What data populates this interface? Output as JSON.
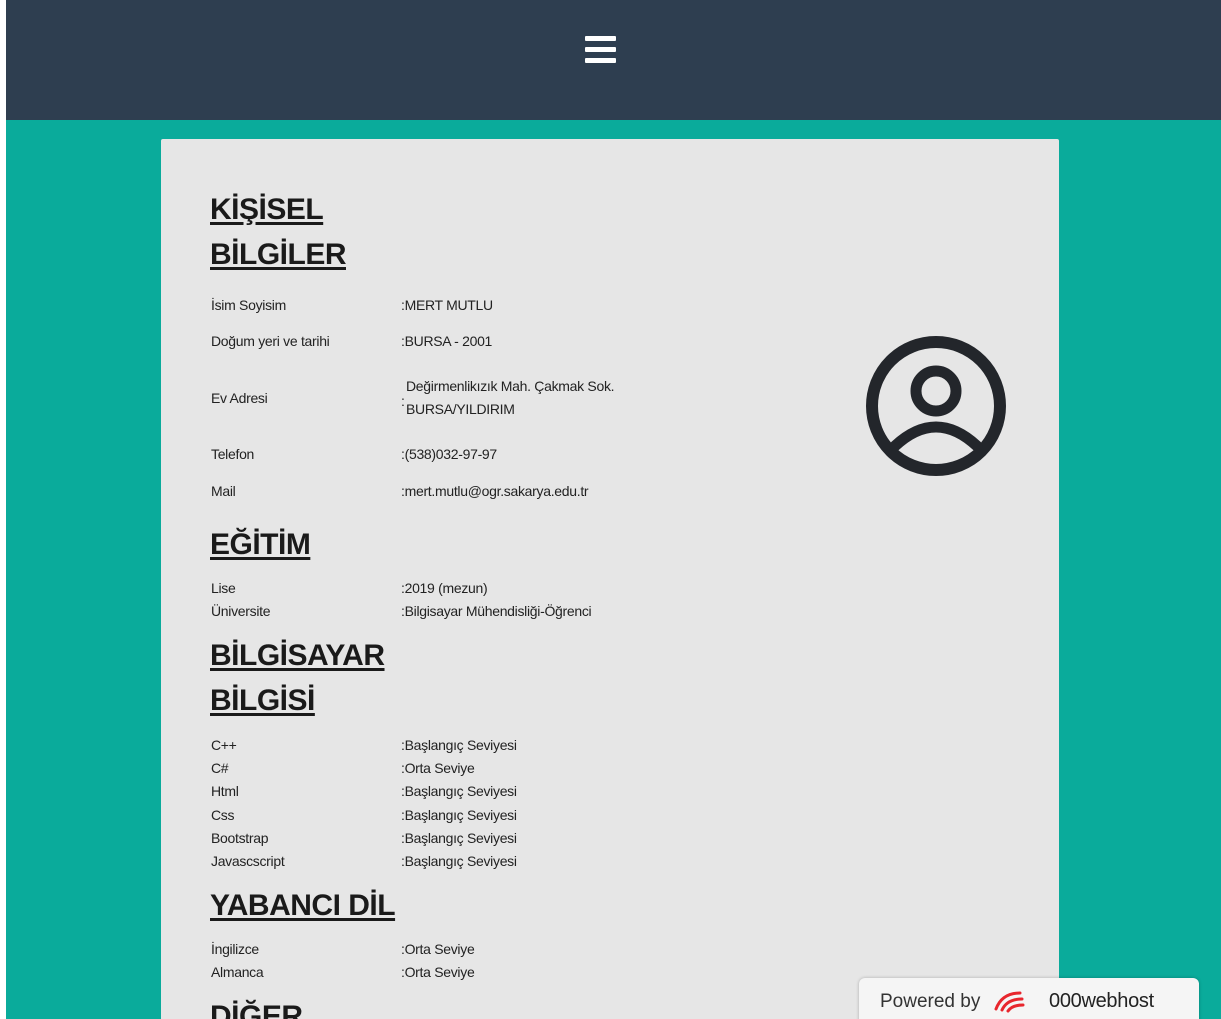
{
  "nav": {
    "menu_icon": "hamburger-icon"
  },
  "sections": {
    "personal": {
      "title_line1": "KİŞİSEL",
      "title_line2": "BİLGİLER",
      "rows": [
        {
          "label": "İsim Soyisim",
          "value": ":MERT MUTLU"
        },
        {
          "label": "Doğum yeri ve tarihi",
          "value": ":BURSA - 2001"
        },
        {
          "label": "Ev Adresi",
          "value_colon": ":",
          "value_line1": "Değirmenlikızık Mah. Çakmak Sok.",
          "value_line2": "BURSA/YILDIRIM"
        },
        {
          "label": "Telefon",
          "value": ":(538)032-97-97"
        },
        {
          "label": "Mail",
          "value": ":mert.mutlu@ogr.sakarya.edu.tr"
        }
      ]
    },
    "education": {
      "title": "EĞİTİM",
      "rows": [
        {
          "label": "Lise",
          "value": ":2019 (mezun)"
        },
        {
          "label": "Üniversite",
          "value": ":Bilgisayar Mühendisliği-Öğrenci"
        }
      ]
    },
    "computer": {
      "title_line1": "BİLGİSAYAR",
      "title_line2": "BİLGİSİ",
      "rows": [
        {
          "label": "C++",
          "value": ":Başlangıç Seviyesi"
        },
        {
          "label": "C#",
          "value": ":Orta Seviye"
        },
        {
          "label": "Html",
          "value": ":Başlangıç Seviyesi"
        },
        {
          "label": "Css",
          "value": ":Başlangıç Seviyesi"
        },
        {
          "label": "Bootstrap",
          "value": ":Başlangıç Seviyesi"
        },
        {
          "label": "Javascscript",
          "value": ":Başlangıç Seviyesi"
        }
      ]
    },
    "language": {
      "title": "YABANCI DİL",
      "rows": [
        {
          "label": "İngilizce",
          "value": ":Orta Seviye"
        },
        {
          "label": "Almanca",
          "value": ":Orta Seviye"
        }
      ]
    },
    "other": {
      "title": "DİĞER"
    }
  },
  "avatar": {
    "icon": "user-circle-icon"
  },
  "badge": {
    "powered_by": "Powered by",
    "brand": "000webhost",
    "logo_icon": "000webhost-logo-icon"
  },
  "colors": {
    "topbar": "#2e3e50",
    "background": "#0aab9b",
    "card": "#e6e6e6",
    "logo_red": "#e8262d"
  }
}
